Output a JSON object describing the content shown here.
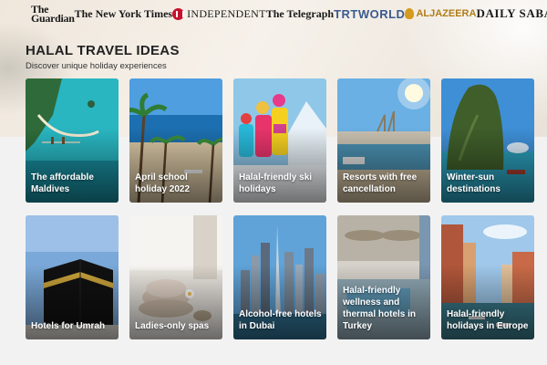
{
  "publishers": {
    "guardian_line1": "The",
    "guardian_line2": "Guardian",
    "nyt": "The New York Times",
    "independent": "INDEPENDENT",
    "telegraph": "The Telegraph",
    "trt": "TRTWORLD",
    "aljazeera": "ALJAZEERA",
    "dailysabah": "DAILY SABAH"
  },
  "section": {
    "title": "HALAL TRAVEL IDEAS",
    "subtitle": "Discover unique holiday experiences"
  },
  "cards": [
    {
      "label": "The affordable Maldives"
    },
    {
      "label": "April school holiday 2022"
    },
    {
      "label": "Halal-friendly ski holidays"
    },
    {
      "label": "Resorts with free cancellation"
    },
    {
      "label": "Winter-sun destinations"
    },
    {
      "label": "Hotels for Umrah"
    },
    {
      "label": "Ladies-only spas"
    },
    {
      "label": "Alcohol-free hotels in Dubai"
    },
    {
      "label": "Halal-friendly wellness and thermal hotels in Turkey"
    },
    {
      "label": "Halal-friendly holidays in Europe"
    }
  ],
  "colors": {
    "independent_red": "#c8102e",
    "trt_blue": "#3b5a8f",
    "aljazeera_gold": "#d59a1e"
  }
}
